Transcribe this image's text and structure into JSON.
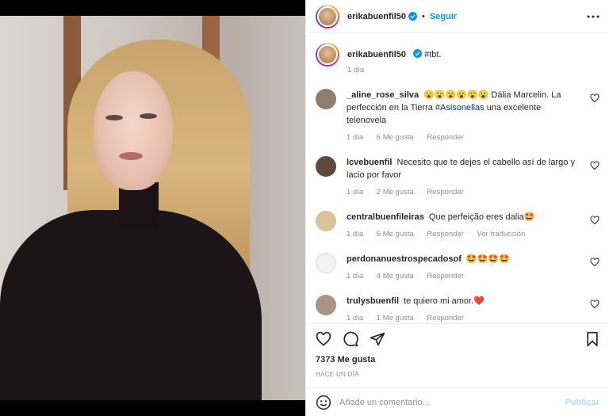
{
  "post": {
    "author": "erikabuenfil50",
    "follow_label": "Seguir",
    "caption_tag": "#tbt.",
    "caption_time": "1 día",
    "likes": "7373 Me gusta",
    "posted_ago": "HACE UN DÍA"
  },
  "comments": [
    {
      "user": "_aline_rose_silva",
      "pre_emoji": "😮😮😮😮😮😮",
      "text": " Dália Marcelin. La perfección en la Tierra ",
      "tag": "#Asisonellas",
      "text_after": " una excelente telenovela",
      "time": "1 día",
      "likes": "6 Me gusta",
      "reply": "Responder",
      "avatar_color": "#8f7e6c"
    },
    {
      "user": "lcvebuenfil",
      "text": "Necesito que te dejes el cabello así de largo y lacio por favor",
      "time": "1 día",
      "likes": "2 Me gusta",
      "reply": "Responder",
      "avatar_color": "#5e4a3c"
    },
    {
      "user": "centralbuenfileiras",
      "text": "Que perfeição eres dalia🤩",
      "time": "1 día",
      "likes": "5 Me gusta",
      "reply": "Responder",
      "translate": "Ver traducción",
      "avatar_color": "#d9c39a"
    },
    {
      "user": "perdonanuestrospecadosof",
      "text": "🤩🤩🤩🤩",
      "time": "1 día",
      "likes": "4 Me gusta",
      "reply": "Responder",
      "avatar_color": "#f2f2f2"
    },
    {
      "user": "trulysbuenfil",
      "text": "te quiero mi amor.❤️",
      "time": "1 día",
      "likes": "1 Me gusta",
      "reply": "Responder",
      "avatar_color": "#a89484"
    }
  ],
  "composer": {
    "placeholder": "Añade un comentario...",
    "publish_label": "Publicar"
  },
  "icons": {
    "verified": "verified-badge-icon",
    "more": "more-options-icon",
    "like": "heart-icon",
    "comment": "comment-icon",
    "share": "share-icon",
    "save": "bookmark-icon",
    "emoji": "emoji-icon"
  },
  "colors": {
    "link": "#0095f6",
    "tag": "#00376b",
    "muted": "#8e8e8e"
  }
}
